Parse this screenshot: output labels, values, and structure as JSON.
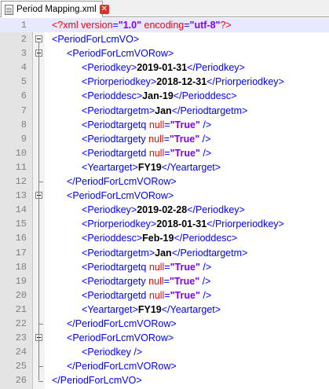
{
  "tab": {
    "title": "Period Mapping.xml",
    "close_glyph": "✕"
  },
  "lines": [
    {
      "n": "1",
      "indent": 0,
      "fold": "",
      "tokens": [
        [
          "pi",
          "<?xml "
        ],
        [
          "at",
          "version"
        ],
        [
          "tg",
          "="
        ],
        [
          "av",
          "\"1.0\""
        ],
        [
          "at",
          " encoding"
        ],
        [
          "tg",
          "="
        ],
        [
          "av",
          "\"utf-8\""
        ],
        [
          "pi",
          "?>"
        ]
      ]
    },
    {
      "n": "2",
      "indent": 0,
      "fold": "open",
      "tokens": [
        [
          "br",
          "<"
        ],
        [
          "tg",
          "PeriodForLcmVO"
        ],
        [
          "br",
          ">"
        ]
      ]
    },
    {
      "n": "3",
      "indent": 1,
      "fold": "open",
      "tokens": [
        [
          "br",
          "<"
        ],
        [
          "tg",
          "PeriodForLcmVORow"
        ],
        [
          "br",
          ">"
        ]
      ]
    },
    {
      "n": "4",
      "indent": 2,
      "fold": "",
      "tokens": [
        [
          "br",
          "<"
        ],
        [
          "tg",
          "Periodkey"
        ],
        [
          "br",
          ">"
        ],
        [
          "tx",
          "2019-01-31"
        ],
        [
          "br",
          "</"
        ],
        [
          "tg",
          "Periodkey"
        ],
        [
          "br",
          ">"
        ]
      ]
    },
    {
      "n": "5",
      "indent": 2,
      "fold": "",
      "tokens": [
        [
          "br",
          "<"
        ],
        [
          "tg",
          "Priorperiodkey"
        ],
        [
          "br",
          ">"
        ],
        [
          "tx",
          "2018-12-31"
        ],
        [
          "br",
          "</"
        ],
        [
          "tg",
          "Priorperiodkey"
        ],
        [
          "br",
          ">"
        ]
      ]
    },
    {
      "n": "6",
      "indent": 2,
      "fold": "",
      "tokens": [
        [
          "br",
          "<"
        ],
        [
          "tg",
          "Perioddesc"
        ],
        [
          "br",
          ">"
        ],
        [
          "tx",
          "Jan-19"
        ],
        [
          "br",
          "</"
        ],
        [
          "tg",
          "Perioddesc"
        ],
        [
          "br",
          ">"
        ]
      ]
    },
    {
      "n": "7",
      "indent": 2,
      "fold": "",
      "tokens": [
        [
          "br",
          "<"
        ],
        [
          "tg",
          "Periodtargetm"
        ],
        [
          "br",
          ">"
        ],
        [
          "tx",
          "Jan"
        ],
        [
          "br",
          "</"
        ],
        [
          "tg",
          "Periodtargetm"
        ],
        [
          "br",
          ">"
        ]
      ]
    },
    {
      "n": "8",
      "indent": 2,
      "fold": "",
      "tokens": [
        [
          "br",
          "<"
        ],
        [
          "tg",
          "Periodtargetq "
        ],
        [
          "at",
          "null"
        ],
        [
          "tg",
          "="
        ],
        [
          "av",
          "\"True\""
        ],
        [
          "br",
          " />"
        ]
      ]
    },
    {
      "n": "9",
      "indent": 2,
      "fold": "",
      "tokens": [
        [
          "br",
          "<"
        ],
        [
          "tg",
          "Periodtargety "
        ],
        [
          "at",
          "null"
        ],
        [
          "tg",
          "="
        ],
        [
          "av",
          "\"True\""
        ],
        [
          "br",
          " />"
        ]
      ]
    },
    {
      "n": "10",
      "indent": 2,
      "fold": "",
      "tokens": [
        [
          "br",
          "<"
        ],
        [
          "tg",
          "Periodtargetd "
        ],
        [
          "at",
          "null"
        ],
        [
          "tg",
          "="
        ],
        [
          "av",
          "\"True\""
        ],
        [
          "br",
          " />"
        ]
      ]
    },
    {
      "n": "11",
      "indent": 2,
      "fold": "",
      "tokens": [
        [
          "br",
          "<"
        ],
        [
          "tg",
          "Yeartarget"
        ],
        [
          "br",
          ">"
        ],
        [
          "tx",
          "FY19"
        ],
        [
          "br",
          "</"
        ],
        [
          "tg",
          "Yeartarget"
        ],
        [
          "br",
          ">"
        ]
      ]
    },
    {
      "n": "12",
      "indent": 1,
      "fold": "end",
      "tokens": [
        [
          "br",
          "</"
        ],
        [
          "tg",
          "PeriodForLcmVORow"
        ],
        [
          "br",
          ">"
        ]
      ]
    },
    {
      "n": "13",
      "indent": 1,
      "fold": "open",
      "tokens": [
        [
          "br",
          "<"
        ],
        [
          "tg",
          "PeriodForLcmVORow"
        ],
        [
          "br",
          ">"
        ]
      ]
    },
    {
      "n": "14",
      "indent": 2,
      "fold": "",
      "tokens": [
        [
          "br",
          "<"
        ],
        [
          "tg",
          "Periodkey"
        ],
        [
          "br",
          ">"
        ],
        [
          "tx",
          "2019-02-28"
        ],
        [
          "br",
          "</"
        ],
        [
          "tg",
          "Periodkey"
        ],
        [
          "br",
          ">"
        ]
      ]
    },
    {
      "n": "15",
      "indent": 2,
      "fold": "",
      "tokens": [
        [
          "br",
          "<"
        ],
        [
          "tg",
          "Priorperiodkey"
        ],
        [
          "br",
          ">"
        ],
        [
          "tx",
          "2018-01-31"
        ],
        [
          "br",
          "</"
        ],
        [
          "tg",
          "Priorperiodkey"
        ],
        [
          "br",
          ">"
        ]
      ]
    },
    {
      "n": "16",
      "indent": 2,
      "fold": "",
      "tokens": [
        [
          "br",
          "<"
        ],
        [
          "tg",
          "Perioddesc"
        ],
        [
          "br",
          ">"
        ],
        [
          "tx",
          "Feb-19"
        ],
        [
          "br",
          "</"
        ],
        [
          "tg",
          "Perioddesc"
        ],
        [
          "br",
          ">"
        ]
      ]
    },
    {
      "n": "17",
      "indent": 2,
      "fold": "",
      "tokens": [
        [
          "br",
          "<"
        ],
        [
          "tg",
          "Periodtargetm"
        ],
        [
          "br",
          ">"
        ],
        [
          "tx",
          "Jan"
        ],
        [
          "br",
          "</"
        ],
        [
          "tg",
          "Periodtargetm"
        ],
        [
          "br",
          ">"
        ]
      ]
    },
    {
      "n": "18",
      "indent": 2,
      "fold": "",
      "tokens": [
        [
          "br",
          "<"
        ],
        [
          "tg",
          "Periodtargetq "
        ],
        [
          "at",
          "null"
        ],
        [
          "tg",
          "="
        ],
        [
          "av",
          "\"True\""
        ],
        [
          "br",
          " />"
        ]
      ]
    },
    {
      "n": "19",
      "indent": 2,
      "fold": "",
      "tokens": [
        [
          "br",
          "<"
        ],
        [
          "tg",
          "Periodtargety "
        ],
        [
          "at",
          "null"
        ],
        [
          "tg",
          "="
        ],
        [
          "av",
          "\"True\""
        ],
        [
          "br",
          " />"
        ]
      ]
    },
    {
      "n": "20",
      "indent": 2,
      "fold": "",
      "tokens": [
        [
          "br",
          "<"
        ],
        [
          "tg",
          "Periodtargetd "
        ],
        [
          "at",
          "null"
        ],
        [
          "tg",
          "="
        ],
        [
          "av",
          "\"True\""
        ],
        [
          "br",
          " />"
        ]
      ]
    },
    {
      "n": "21",
      "indent": 2,
      "fold": "",
      "tokens": [
        [
          "br",
          "<"
        ],
        [
          "tg",
          "Yeartarget"
        ],
        [
          "br",
          ">"
        ],
        [
          "tx",
          "FY19"
        ],
        [
          "br",
          "</"
        ],
        [
          "tg",
          "Yeartarget"
        ],
        [
          "br",
          ">"
        ]
      ]
    },
    {
      "n": "22",
      "indent": 1,
      "fold": "end",
      "tokens": [
        [
          "br",
          "</"
        ],
        [
          "tg",
          "PeriodForLcmVORow"
        ],
        [
          "br",
          ">"
        ]
      ]
    },
    {
      "n": "23",
      "indent": 1,
      "fold": "open",
      "tokens": [
        [
          "br",
          "<"
        ],
        [
          "tg",
          "PeriodForLcmVORow"
        ],
        [
          "br",
          ">"
        ]
      ]
    },
    {
      "n": "24",
      "indent": 2,
      "fold": "",
      "tokens": [
        [
          "br",
          "<"
        ],
        [
          "tg",
          "Periodkey"
        ],
        [
          "br",
          " />"
        ]
      ]
    },
    {
      "n": "25",
      "indent": 1,
      "fold": "end",
      "tokens": [
        [
          "br",
          "</"
        ],
        [
          "tg",
          "PeriodForLcmVORow"
        ],
        [
          "br",
          ">"
        ]
      ]
    },
    {
      "n": "26",
      "indent": 0,
      "fold": "end",
      "tokens": [
        [
          "br",
          "</"
        ],
        [
          "tg",
          "PeriodForLcmVO"
        ],
        [
          "br",
          ">"
        ]
      ]
    }
  ],
  "current_line": "1",
  "colors": {
    "tag": "#0000ff",
    "attr": "#ff0000",
    "value": "#8000ff",
    "text": "#000000",
    "gutter": "#e4e4e4"
  }
}
